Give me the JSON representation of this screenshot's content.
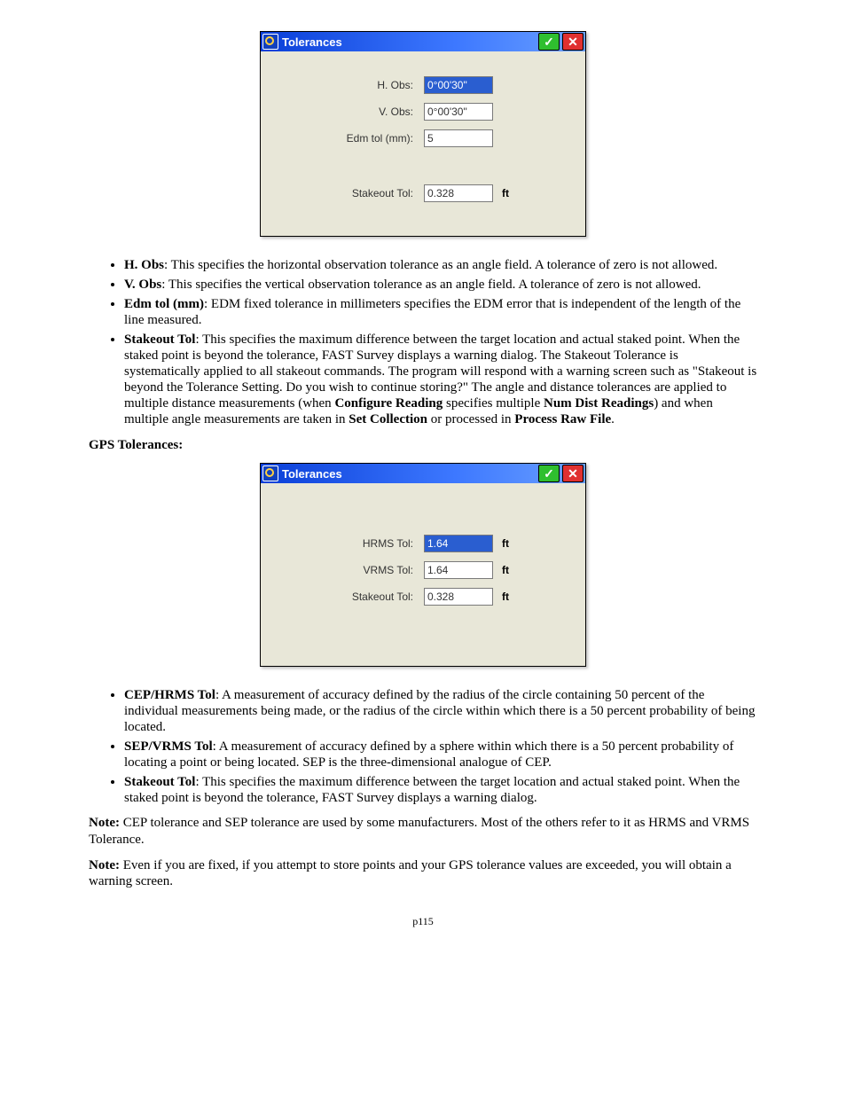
{
  "dialog1": {
    "title": "Tolerances",
    "rows": [
      {
        "label": "H. Obs:",
        "value": "0°00'30\"",
        "unit": "",
        "selected": true
      },
      {
        "label": "V. Obs:",
        "value": "0°00'30\"",
        "unit": "",
        "selected": false
      },
      {
        "label": "Edm tol (mm):",
        "value": "5",
        "unit": "",
        "selected": false
      }
    ],
    "stakeout": {
      "label": "Stakeout Tol:",
      "value": "0.328",
      "unit": "ft"
    }
  },
  "bullets1": [
    {
      "term": "H. Obs",
      "text": ":  This specifies the horizontal observation tolerance as an angle field. A tolerance of zero is not allowed."
    },
    {
      "term": "V. Obs",
      "text": ":  This specifies the vertical observation tolerance as an angle field. A tolerance of zero is not allowed."
    },
    {
      "term": "Edm tol (mm)",
      "text": ": EDM fixed tolerance in millimeters specifies the EDM error that is independent of the length of the line measured."
    }
  ],
  "bullet1_stakeout": {
    "term": "Stakeout Tol",
    "pre": ":  This specifies the maximum difference between the target location and actual staked point. When the staked point is beyond the tolerance, FAST Survey displays a warning dialog. The Stakeout Tolerance is systematically applied to all stakeout commands.  The program will respond with a warning screen such as \"Stakeout is beyond the Tolerance Setting.  Do you wish to continue storing?\"  The angle and distance tolerances are applied to multiple distance measurements (when ",
    "bold1": "Configure Reading",
    "mid1": " specifies multiple ",
    "bold2": "Num Dist Readings",
    "mid2": ") and when multiple angle measurements are taken in ",
    "bold3": "Set Collection",
    "mid3": " or processed in ",
    "bold4": "Process Raw File",
    "post": "."
  },
  "gps_heading": "GPS Tolerances:",
  "dialog2": {
    "title": "Tolerances",
    "rows": [
      {
        "label": "HRMS Tol:",
        "value": "1.64",
        "unit": "ft",
        "selected": true
      },
      {
        "label": "VRMS Tol:",
        "value": "1.64",
        "unit": "ft",
        "selected": false
      },
      {
        "label": "Stakeout Tol:",
        "value": "0.328",
        "unit": "ft",
        "selected": false
      }
    ]
  },
  "bullets2": [
    {
      "term": "CEP/HRMS Tol",
      "text": ":  A measurement of accuracy defined by the radius of the circle containing 50 percent of the individual measurements being made, or the radius of the circle within which there is a 50 percent probability of being located."
    },
    {
      "term": "SEP/VRMS Tol",
      "text": ":  A measurement of accuracy defined by a sphere within which there is a 50 percent probability of locating a point or being located. SEP is the three-dimensional analogue of CEP."
    },
    {
      "term": "Stakeout Tol",
      "text": ":  This specifies the maximum difference between the target location and actual staked point. When the staked point is beyond the tolerance, FAST Survey displays a warning dialog."
    }
  ],
  "note1": {
    "label": "Note:",
    "text": " CEP tolerance and SEP tolerance are used by some manufacturers. Most of the others refer to it as HRMS and VRMS Tolerance."
  },
  "note2": {
    "label": "Note:",
    "text": " Even if you are fixed, if you attempt to store points and your GPS tolerance values are exceeded, you will obtain a warning screen."
  },
  "page": "p115"
}
